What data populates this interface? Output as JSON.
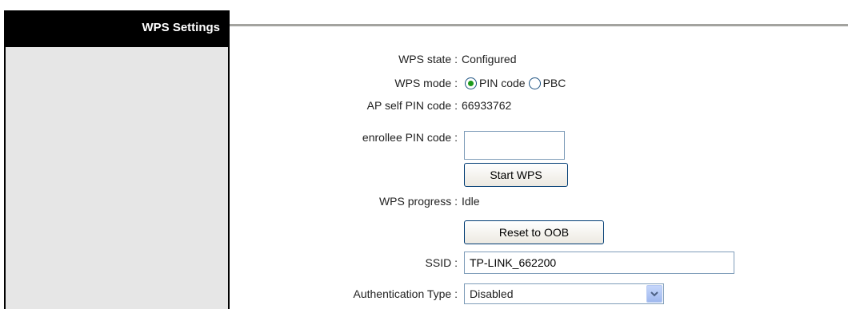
{
  "header": {
    "title": "WPS Settings"
  },
  "fields": {
    "wps_state": {
      "label": "WPS state :",
      "value": "Configured"
    },
    "wps_mode": {
      "label": "WPS mode :",
      "options": [
        "PIN code",
        "PBC"
      ],
      "selected": "PIN code"
    },
    "ap_self_pin": {
      "label": "AP self PIN code :",
      "value": "66933762"
    },
    "enrollee_pin": {
      "label": "enrollee PIN code :",
      "value": ""
    },
    "start_wps_button": "Start WPS",
    "wps_progress": {
      "label": "WPS progress :",
      "value": "Idle"
    },
    "reset_oob_button": "Reset to OOB",
    "ssid": {
      "label": "SSID :",
      "value": "TP-LINK_662200"
    },
    "auth_type": {
      "label": "Authentication Type :",
      "value": "Disabled"
    }
  },
  "colors": {
    "title_bg": "#000000",
    "sidebar_bg": "#e6e6e6",
    "rule": "#a3a39f",
    "radio_dot": "#1d9a1d"
  }
}
